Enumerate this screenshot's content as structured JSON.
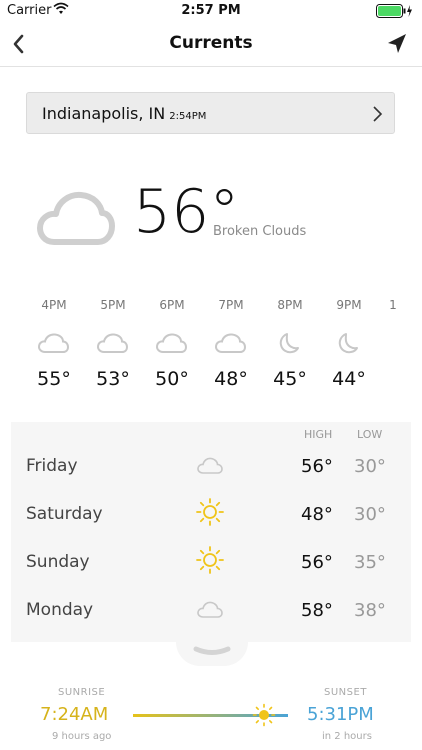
{
  "status": {
    "carrier": "Carrier",
    "time": "2:57 PM"
  },
  "nav": {
    "title": "Currents"
  },
  "location": {
    "city": "Indianapolis, IN",
    "time": "2:54PM"
  },
  "current": {
    "temp": "56°",
    "condition": "Broken Clouds"
  },
  "hourly": [
    {
      "label": "4PM",
      "temp": "55°",
      "icon": "cloud-icon"
    },
    {
      "label": "5PM",
      "temp": "53°",
      "icon": "cloud-icon"
    },
    {
      "label": "6PM",
      "temp": "50°",
      "icon": "cloud-icon"
    },
    {
      "label": "7PM",
      "temp": "48°",
      "icon": "cloud-icon"
    },
    {
      "label": "8PM",
      "temp": "45°",
      "icon": "moon-icon"
    },
    {
      "label": "9PM",
      "temp": "44°",
      "icon": "moon-icon"
    },
    {
      "label": "1",
      "temp": "",
      "icon": ""
    }
  ],
  "daily": {
    "high_label": "HIGH",
    "low_label": "LOW",
    "days": [
      {
        "name": "Friday",
        "high": "56°",
        "low": "30°",
        "icon": "cloud-icon"
      },
      {
        "name": "Saturday",
        "high": "48°",
        "low": "30°",
        "icon": "sun-icon"
      },
      {
        "name": "Sunday",
        "high": "56°",
        "low": "35°",
        "icon": "sun-icon"
      },
      {
        "name": "Monday",
        "high": "58°",
        "low": "38°",
        "icon": "cloud-icon"
      }
    ]
  },
  "sun": {
    "sunrise_label": "SUNRISE",
    "sunrise_time": "7:24AM",
    "sunrise_rel": "9 hours ago",
    "sunset_label": "SUNSET",
    "sunset_time": "5:31PM",
    "sunset_rel": "in 2 hours",
    "sunrise_color": "#e6c21a",
    "sunset_color": "#4aa3d6"
  },
  "colors": {
    "sun": "#f0c419",
    "battery": "#4cd964",
    "cloud": "#c8c8c8"
  }
}
